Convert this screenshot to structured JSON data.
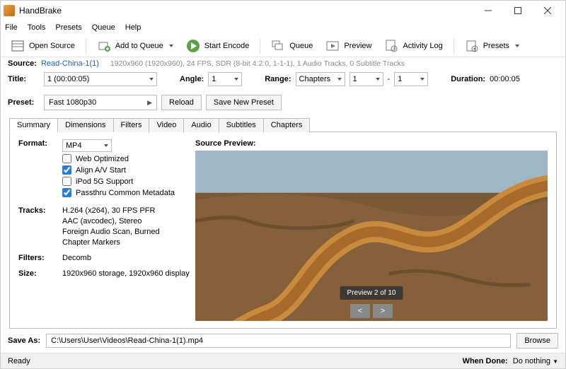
{
  "window": {
    "title": "HandBrake"
  },
  "menu": {
    "file": "File",
    "tools": "Tools",
    "presets": "Presets",
    "queue": "Queue",
    "help": "Help"
  },
  "toolbar": {
    "open_source": "Open Source",
    "add_to_queue": "Add to Queue",
    "start_encode": "Start Encode",
    "queue": "Queue",
    "preview": "Preview",
    "activity_log": "Activity Log",
    "presets": "Presets"
  },
  "source": {
    "label": "Source:",
    "name": "Read-China-1(1)",
    "info": "1920x960 (1920x960), 24 FPS, SDR (8-bit 4:2:0, 1-1-1), 1 Audio Tracks, 0 Subtitle Tracks"
  },
  "title_row": {
    "title_label": "Title:",
    "title_value": "1  (00:00:05)",
    "angle_label": "Angle:",
    "angle_value": "1",
    "range_label": "Range:",
    "range_type": "Chapters",
    "range_from": "1",
    "range_sep": "-",
    "range_to": "1",
    "duration_label": "Duration:",
    "duration_value": "00:00:05"
  },
  "preset_row": {
    "preset_label": "Preset:",
    "preset_value": "Fast 1080p30",
    "reload": "Reload",
    "save_new": "Save New Preset"
  },
  "tabs": {
    "summary": "Summary",
    "dimensions": "Dimensions",
    "filters": "Filters",
    "video": "Video",
    "audio": "Audio",
    "subtitles": "Subtitles",
    "chapters": "Chapters"
  },
  "summary": {
    "format_label": "Format:",
    "format_value": "MP4",
    "web_optimized": "Web Optimized",
    "align_av": "Align A/V Start",
    "ipod": "iPod 5G Support",
    "passthru": "Passthru Common Metadata",
    "tracks_label": "Tracks:",
    "tracks_line1": "H.264 (x264), 30 FPS PFR",
    "tracks_line2": "AAC (avcodec), Stereo",
    "tracks_line3": "Foreign Audio Scan, Burned",
    "tracks_line4": "Chapter Markers",
    "filters_label": "Filters:",
    "filters_value": "Decomb",
    "size_label": "Size:",
    "size_value": "1920x960 storage, 1920x960 display",
    "preview_label": "Source Preview:",
    "preview_badge": "Preview 2 of 10",
    "prev_btn": "<",
    "next_btn": ">"
  },
  "saveas": {
    "label": "Save As:",
    "path": "C:\\Users\\User\\Videos\\Read-China-1(1).mp4",
    "browse": "Browse"
  },
  "status": {
    "ready": "Ready",
    "when_done_label": "When Done:",
    "when_done_value": "Do nothing"
  }
}
